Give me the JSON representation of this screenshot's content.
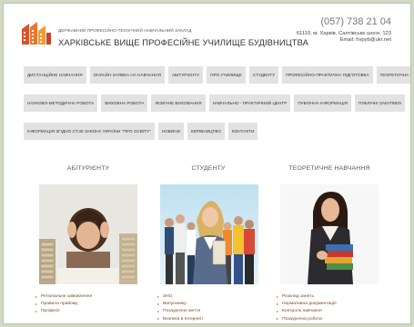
{
  "header": {
    "org_small": "ДЕРЖАВНИЙ ПРОФЕСІЙНО-ТЕХНІЧНИЙ НАВЧАЛЬНИЙ ЗАКЛАД",
    "org_name": "ХАРКІВСЬКЕ ВИЩЕ ПРОФЕСІЙНЕ УЧИЛИЩЕ БУДІВНИЦТВА",
    "phone": "(057) 738 21 04",
    "address": "61110, м. Харків, Салтівське шосе, 123",
    "email": "Email: hvpyb@ukr.net"
  },
  "nav": {
    "row1": [
      "ДИСТАНЦІЙНЕ НАВЧАННЯ",
      "ОНЛАЙН ЗАЯВКА НА НАВЧАННЯ",
      "АБІТУРІЄНТУ",
      "ПРО УЧИЛИЩЕ",
      "СТУДЕНТУ",
      "ПРОФЕСІЙНО-ПРАКТИЧНА ПІДГОТОВКА",
      "ТЕОРЕТИЧНА ПІДГОТОВКА"
    ],
    "row2": [
      "НАУКОВО-МЕТОДИЧНА РОБОТА",
      "ВИХОВНА РОБОТА",
      "ФІЗИЧНЕ ВИХОВАННЯ",
      "НАВЧАЛЬНО - ПРАКТИЧНИЙ ЦЕНТР",
      "ПУБЛІЧНА ІНФОРМАЦІЯ",
      "ПУБЛІЧНІ ЗАКУПІВЛІ"
    ],
    "row3": [
      "ІНФОРМАЦІЯ ЗГІДНО СТ.30 ЗАКОНУ УКРАЇНИ \"ПРО ОСВІТУ\"",
      "НОВИНИ",
      "КЕРІВНИЦТВО",
      "КОНТАКТИ"
    ]
  },
  "sections": {
    "abiturient": {
      "title": "АБІТУРІЄНТУ",
      "links": [
        "Регіональне замовлення",
        "Правила прийому",
        "Професії"
      ]
    },
    "student": {
      "title": "СТУДЕНТУ",
      "links": [
        "ЗНО",
        "Випускнику",
        "Позаурочне життя",
        "Безпека в Інтернеті"
      ]
    },
    "theory": {
      "title": "ТЕОРЕТИЧНЕ НАВЧАННЯ",
      "links": [
        "Розклад занять",
        "Нормативна документація",
        "Контроль навчання",
        "Позаурочна робота"
      ]
    }
  },
  "colors": {
    "accent": "#c9502a",
    "link": "#7a4a22",
    "nav_bg": "#e2e2e2"
  }
}
